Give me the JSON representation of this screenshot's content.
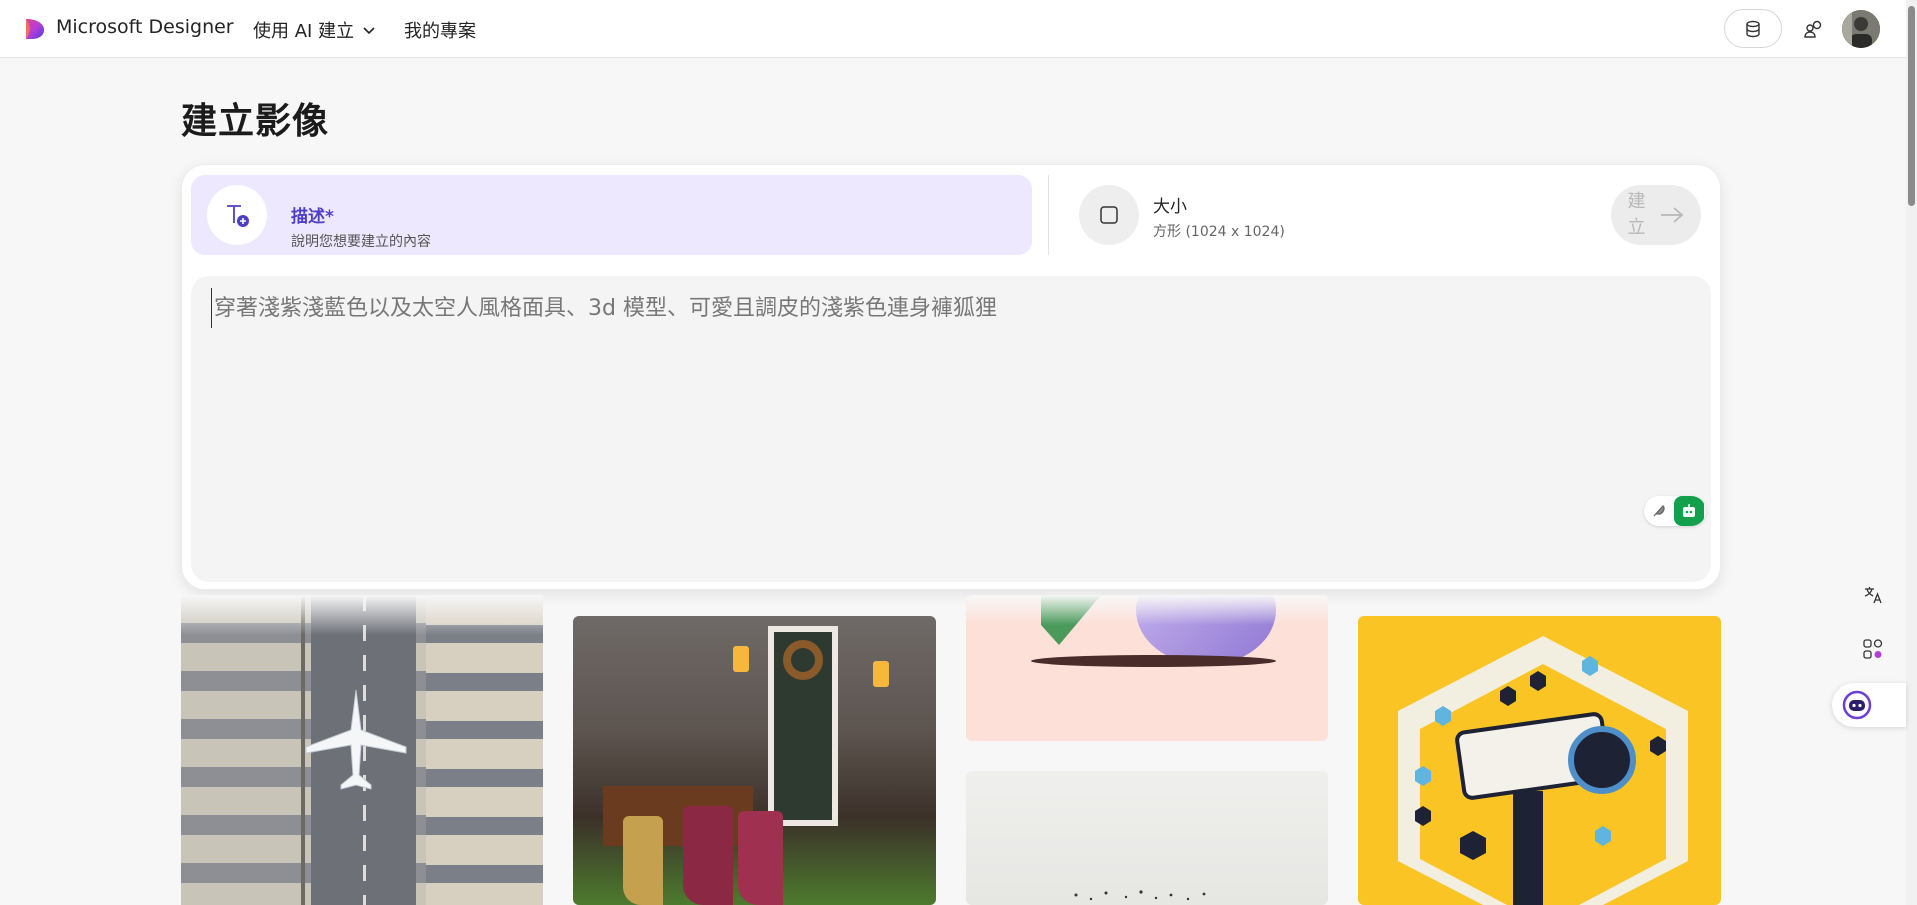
{
  "app": {
    "brand": "Microsoft Designer"
  },
  "nav": {
    "create_with_ai": "使用 AI 建立",
    "my_projects": "我的專案"
  },
  "page": {
    "title": "建立影像"
  },
  "describe": {
    "title": "描述*",
    "subtitle": "說明您想要建立的內容"
  },
  "size": {
    "title": "大小",
    "subtitle": "方形 (1024 x 1024)"
  },
  "create_button": {
    "label": "建立"
  },
  "prompt": {
    "placeholder": "穿著淺紫淺藍色以及太空人風格面具、3d 模型、可愛且調皮的淺紫色連身褲狐狸"
  },
  "colors": {
    "accent": "#4f3fc8",
    "describe_bg": "#ede8fd",
    "bot_green": "#13a04d"
  },
  "icons": {
    "logo": "designer-logo-icon",
    "credits": "coin-stack-icon",
    "people": "people-icon",
    "text_add": "text-add-icon",
    "size_square": "square-icon",
    "arrow": "arrow-right-icon",
    "feather": "feather-icon",
    "bot": "bot-icon",
    "translate": "translate-icon",
    "apps": "apps-icon",
    "copilot": "copilot-icon"
  }
}
